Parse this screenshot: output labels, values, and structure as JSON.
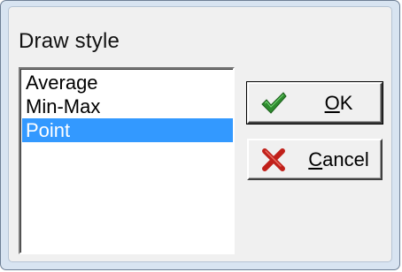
{
  "dialog": {
    "title": "Draw style"
  },
  "list": {
    "items": [
      {
        "label": "Average",
        "selected": false
      },
      {
        "label": "Min-Max",
        "selected": false
      },
      {
        "label": "Point",
        "selected": true
      }
    ],
    "selection_color": "#3399ff"
  },
  "buttons": {
    "ok": {
      "accel": "O",
      "rest": "K",
      "icon": "checkmark-icon",
      "icon_color": "#2e8b2e"
    },
    "cancel": {
      "accel": "C",
      "rest": "ancel",
      "icon": "cross-icon",
      "icon_color": "#c0201a"
    }
  }
}
